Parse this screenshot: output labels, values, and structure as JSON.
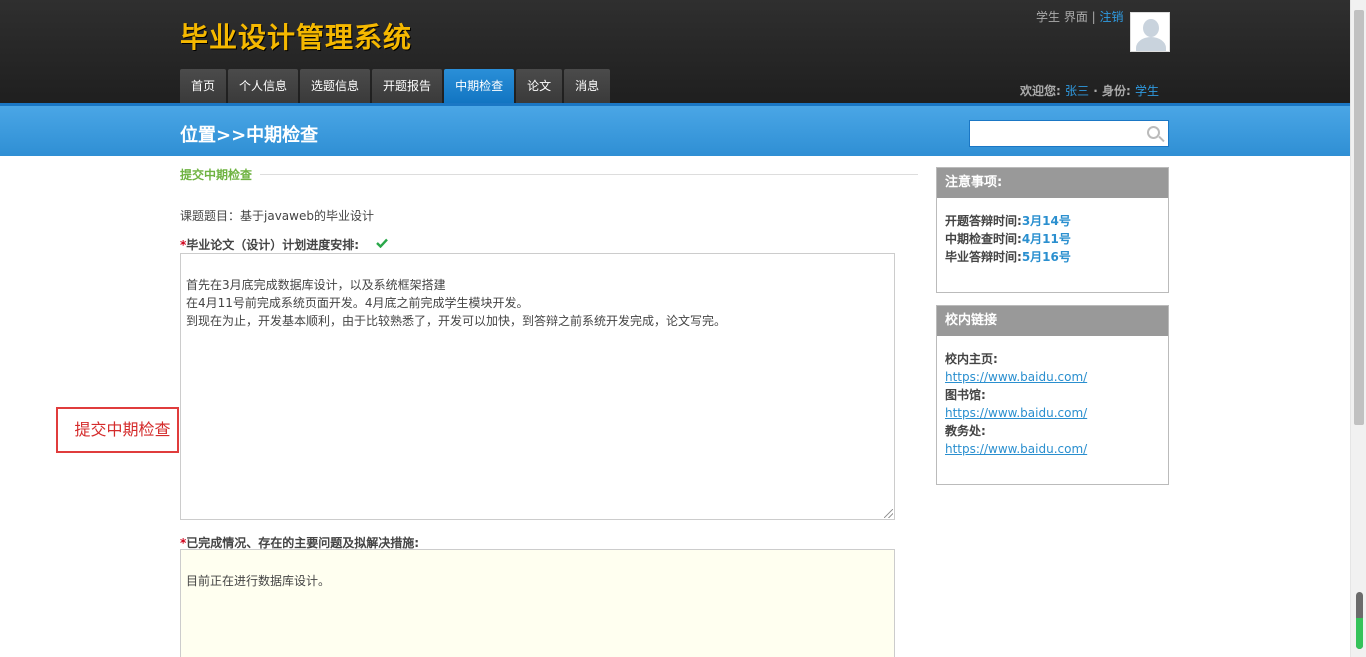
{
  "header": {
    "logo": "毕业设计管理系统",
    "role_label": "学生 界面",
    "logout": "注销",
    "welcome_label": "欢迎您:",
    "user_name": "张三",
    "identity_label": "· 身份:",
    "identity_value": "学生"
  },
  "nav": {
    "tabs": [
      {
        "label": "首页"
      },
      {
        "label": "个人信息"
      },
      {
        "label": "选题信息"
      },
      {
        "label": "开题报告"
      },
      {
        "label": "中期检查"
      },
      {
        "label": "论文"
      },
      {
        "label": "消息"
      }
    ],
    "active": "中期检查"
  },
  "bluebar": {
    "breadcrumb": "位置>>中期检查",
    "search_value": ""
  },
  "main": {
    "section_title": "提交中期检查",
    "topic": "课题题目：基于javaweb的毕业设计",
    "field1_label": "毕业论文（设计）计划进度安排:",
    "field1_value": "首先在3月底完成数据库设计，以及系统框架搭建\n在4月11号前完成系统页面开发。4月底之前完成学生模块开发。\n到现在为止，开发基本顺利，由于比较熟悉了，开发可以加快，到答辩之前系统开发完成，论文写完。",
    "field2_label": "已完成情况、存在的主要问题及拟解决措施:",
    "field2_value": "目前正在进行数据库设计。",
    "required_mark": "*",
    "submit_label": "提交中期检查"
  },
  "sidebar": {
    "notice": {
      "title": "注意事项:",
      "items": [
        {
          "label": "开题答辩时间:",
          "value": "3月14号"
        },
        {
          "label": "中期检查时间:",
          "value": "4月11号"
        },
        {
          "label": "毕业答辩时间:",
          "value": "5月16号"
        }
      ]
    },
    "links": {
      "title": "校内链接",
      "items": [
        {
          "label": "校内主页:",
          "url": "https://www.baidu.com/"
        },
        {
          "label": "图书馆:",
          "url": "https://www.baidu.com/"
        },
        {
          "label": "教务处:",
          "url": "https://www.baidu.com/"
        }
      ]
    }
  },
  "colors": {
    "logo": "#f5b800",
    "active_tab": "#1275c2",
    "section_title": "#6fb342",
    "link": "#2a8fcf",
    "required": "#d0021b"
  },
  "icons": {
    "search": "search-icon",
    "check": "check-icon",
    "avatar": "user-silhouette"
  },
  "scroll_indicator_level": 0.55
}
